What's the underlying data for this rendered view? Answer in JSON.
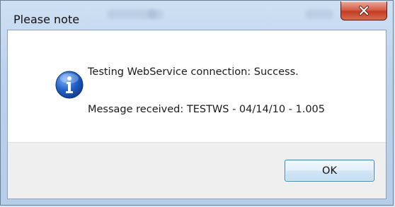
{
  "window": {
    "title": "Please note"
  },
  "message": {
    "line1": "Testing WebService connection: Success.",
    "line2": "Message received: TESTWS - 04/14/10 - 1.005",
    "icon": "info-icon"
  },
  "buttons": {
    "ok_label": "OK",
    "close_icon": "close-icon"
  },
  "colors": {
    "close_red": "#c23e24",
    "info_blue": "#1f5fb8",
    "footer_gray": "#efefef"
  }
}
